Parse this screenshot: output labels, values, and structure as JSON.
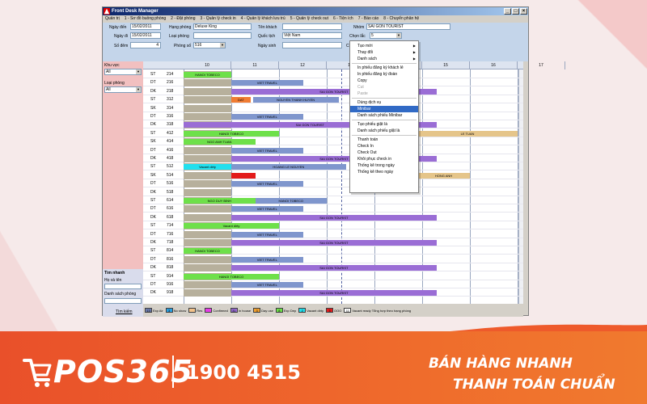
{
  "window": {
    "title": "Front Desk Manager",
    "controls": [
      "_",
      "□",
      "×"
    ]
  },
  "menu": [
    "Quản trị",
    "1 - Sơ đồ buồng phòng",
    "2 - Đặt phòng",
    "3 - Quản lý check in",
    "4 - Quản lý khách lưu trú",
    "5 - Quản lý check out",
    "6 - Tiện ích",
    "7 - Báo cáo",
    "8 - Chuyển phân hệ"
  ],
  "form": {
    "arrival_label": "Ngày đến",
    "arrival_value": "15/02/2011",
    "departure_label": "Ngày đi",
    "departure_value": "15/02/2011",
    "nights_label": "Số đêm",
    "nights_value": "4",
    "roomclass_label": "Hạng phòng",
    "roomclass_value": "Deluxe King",
    "roomtype_label": "Loại phòng",
    "roomtype_value": "",
    "roomno_label": "Phòng số",
    "roomno_value": "516",
    "guest_label": "Tên khách",
    "guest_value": "",
    "nationality_label": "Quốc tịch",
    "nationality_value": "Việt Nam",
    "birthday_label": "Ngày sinh",
    "birthday_value": "",
    "group_label": "Nhóm",
    "group_value": "SAI GON TOURIST",
    "status_label": "Chọn lắc",
    "status_value": "5",
    "other_label": "Ch"
  },
  "left_panel": {
    "area_label": "Khu vực",
    "area_value": "All",
    "roomtype_label": "Loại phòng",
    "roomtype_value": "All",
    "quick_search": {
      "title": "Tìm nhanh",
      "name_label": "Họ và tên",
      "list_label": "Danh sách phòng",
      "button": "Tìm kiếm"
    }
  },
  "grid": {
    "dates": [
      "10",
      "11",
      "12",
      "13",
      "14",
      "15",
      "16",
      "17"
    ],
    "rows": [
      {
        "type": "ST",
        "room": "214",
        "bars": [
          {
            "label": "HANOI TOBECO",
            "color": "#6ee04a",
            "start": 0.0,
            "len": 1.0
          }
        ]
      },
      {
        "type": "DT",
        "room": "216",
        "bars": [
          {
            "label": "VIET TRAVEL",
            "color": "#7f96cd",
            "start": 1.0,
            "len": 1.5
          }
        ]
      },
      {
        "type": "DK",
        "room": "218",
        "bars": [
          {
            "label": "SAI GON TOURIST",
            "color": "#9a6dd5",
            "start": 1.0,
            "len": 4.3
          }
        ]
      },
      {
        "type": "ST",
        "room": "312",
        "bars": [
          {
            "label": "DAT",
            "color": "#f07c33",
            "start": 1.0,
            "len": 0.4
          },
          {
            "label": "NGUYEN THANH HUYEN",
            "color": "#7f96cd",
            "start": 1.45,
            "len": 1.8
          }
        ]
      },
      {
        "type": "SK",
        "room": "314",
        "bars": []
      },
      {
        "type": "DT",
        "room": "316",
        "bars": [
          {
            "label": "VIET TRAVEL",
            "color": "#7f96cd",
            "start": 1.0,
            "len": 1.5
          }
        ]
      },
      {
        "type": "DK",
        "room": "318",
        "bars": [
          {
            "label": "SAI GON TOURIST",
            "color": "#9a6dd5",
            "start": 0.0,
            "len": 5.3
          }
        ]
      },
      {
        "type": "ST",
        "room": "412",
        "bars": [
          {
            "label": "HANOI TOBECO",
            "color": "#6ee04a",
            "start": 0.0,
            "len": 2.0
          },
          {
            "label": "LE TUAN",
            "color": "#e5c58a",
            "start": 4.9,
            "len": 2.1
          }
        ]
      },
      {
        "type": "SK",
        "room": "414",
        "bars": [
          {
            "label": "NGO ANH TUAN",
            "color": "#6ee04a",
            "start": 0.0,
            "len": 1.5
          }
        ]
      },
      {
        "type": "DT",
        "room": "416",
        "bars": [
          {
            "label": "VIET TRAVEL",
            "color": "#7f96cd",
            "start": 1.0,
            "len": 1.5
          }
        ]
      },
      {
        "type": "DK",
        "room": "418",
        "bars": [
          {
            "label": "SAI GON TOURIST",
            "color": "#9a6dd5",
            "start": 1.0,
            "len": 4.3
          }
        ]
      },
      {
        "type": "ST",
        "room": "512",
        "bars": [
          {
            "label": "Vacant dirty",
            "color": "#22e0ee",
            "start": 0.0,
            "len": 1.0
          },
          {
            "label": "HOANG LE NGUYEN",
            "color": "#7f96cd",
            "start": 1.0,
            "len": 2.4
          }
        ]
      },
      {
        "type": "SK",
        "room": "514",
        "bars": [
          {
            "label": "",
            "color": "#e31b1b",
            "start": 1.0,
            "len": 0.5
          },
          {
            "label": "HONG ANH",
            "color": "#e5c58a",
            "start": 4.9,
            "len": 1.1
          }
        ]
      },
      {
        "type": "DT",
        "room": "516",
        "bars": [
          {
            "label": "VIET TRAVEL",
            "color": "#7f96cd",
            "start": 1.0,
            "len": 1.5
          }
        ]
      },
      {
        "type": "DK",
        "room": "518",
        "bars": []
      },
      {
        "type": "ST",
        "room": "614",
        "bars": [
          {
            "label": "NGO DUY BINH",
            "color": "#6ee04a",
            "start": 0.0,
            "len": 1.5
          },
          {
            "label": "HANOI TOBECO",
            "color": "#7f96cd",
            "start": 1.5,
            "len": 1.5
          }
        ]
      },
      {
        "type": "DT",
        "room": "616",
        "bars": [
          {
            "label": "VIET TRAVEL",
            "color": "#7f96cd",
            "start": 1.0,
            "len": 1.5
          }
        ]
      },
      {
        "type": "DK",
        "room": "618",
        "bars": [
          {
            "label": "SAI GON TOURIST",
            "color": "#9a6dd5",
            "start": 1.0,
            "len": 4.3
          }
        ]
      },
      {
        "type": "ST",
        "room": "714",
        "bars": [
          {
            "label": "Vacant dirty",
            "color": "#6ee04a",
            "start": 0.0,
            "len": 2.0
          }
        ]
      },
      {
        "type": "DT",
        "room": "716",
        "bars": [
          {
            "label": "VIET TRAVEL",
            "color": "#7f96cd",
            "start": 1.0,
            "len": 1.5
          }
        ]
      },
      {
        "type": "DK",
        "room": "718",
        "bars": [
          {
            "label": "SAI GON TOURIST",
            "color": "#9a6dd5",
            "start": 1.0,
            "len": 4.3
          }
        ]
      },
      {
        "type": "ST",
        "room": "814",
        "bars": [
          {
            "label": "HANOI TOBECO",
            "color": "#6ee04a",
            "start": 0.0,
            "len": 1.0
          }
        ]
      },
      {
        "type": "DT",
        "room": "816",
        "bars": [
          {
            "label": "VIET TRAVEL",
            "color": "#7f96cd",
            "start": 1.0,
            "len": 1.5
          }
        ]
      },
      {
        "type": "DK",
        "room": "818",
        "bars": [
          {
            "label": "SAI GON TOURIST",
            "color": "#9a6dd5",
            "start": 1.0,
            "len": 4.3
          }
        ]
      },
      {
        "type": "ST",
        "room": "914",
        "bars": [
          {
            "label": "HANOI TOBECO",
            "color": "#6ee04a",
            "start": 0.0,
            "len": 2.0
          }
        ]
      },
      {
        "type": "DT",
        "room": "916",
        "bars": [
          {
            "label": "VIET TRAVEL",
            "color": "#7f96cd",
            "start": 1.0,
            "len": 1.5
          }
        ]
      },
      {
        "type": "DK",
        "room": "918",
        "bars": [
          {
            "label": "SAI GON TOURIST",
            "color": "#9a6dd5",
            "start": 1.0,
            "len": 4.3
          }
        ]
      }
    ]
  },
  "legend": [
    {
      "count": "13",
      "label": "Exp Air",
      "color": "#6f7fb0"
    },
    {
      "count": "3",
      "label": "No show",
      "color": "#2aa0e0"
    },
    {
      "count": "",
      "label": "Res",
      "color": "#f2c28a"
    },
    {
      "count": "",
      "label": "Confirmed",
      "color": "#e83be8"
    },
    {
      "count": "31",
      "label": "In house",
      "color": "#9a6dd5"
    },
    {
      "count": "3",
      "label": "Day use",
      "color": "#f0a030"
    },
    {
      "count": "8",
      "label": "Exp Dep",
      "color": "#6ee04a"
    },
    {
      "count": "2",
      "label": "Vacant dirty",
      "color": "#22e0ee"
    },
    {
      "count": "3",
      "label": "OOO",
      "color": "#e31b1b"
    },
    {
      "count": "11",
      "label": "Vacant ready Tổng hợp theo hạng phòng",
      "color": "#ffffff"
    }
  ],
  "context_menu": [
    {
      "label": "Tạo mới",
      "sub": true
    },
    {
      "label": "Thay đổi",
      "sub": true
    },
    {
      "label": "Danh sách",
      "sub": true
    },
    {
      "sep": true
    },
    {
      "label": "In phiếu đăng ký khách lẻ"
    },
    {
      "label": "In phiếu đăng ký đoàn"
    },
    {
      "label": "Copy"
    },
    {
      "label": "Cut",
      "disabled": true
    },
    {
      "label": "Paste",
      "disabled": true
    },
    {
      "sep": true
    },
    {
      "label": "Dùng dịch vụ"
    },
    {
      "label": "Minibar",
      "selected": true
    },
    {
      "label": "Danh sách phiếu Minibar"
    },
    {
      "sep": true
    },
    {
      "label": "Tạo phiếu giặt là"
    },
    {
      "label": "Danh sách phiếu giặt là"
    },
    {
      "sep": true
    },
    {
      "label": "Thanh toán"
    },
    {
      "label": "Check In"
    },
    {
      "label": "Check Out"
    },
    {
      "label": "Khôi phục check in"
    },
    {
      "label": "Thống kê trong ngày"
    },
    {
      "label": "Thống kê theo ngày"
    }
  ],
  "banner": {
    "logo": "POS365",
    "hotline": "1900 4515",
    "slogan1": "BÁN HÀNG NHANH",
    "slogan2": "THANH TOÁN CHUẨN"
  }
}
